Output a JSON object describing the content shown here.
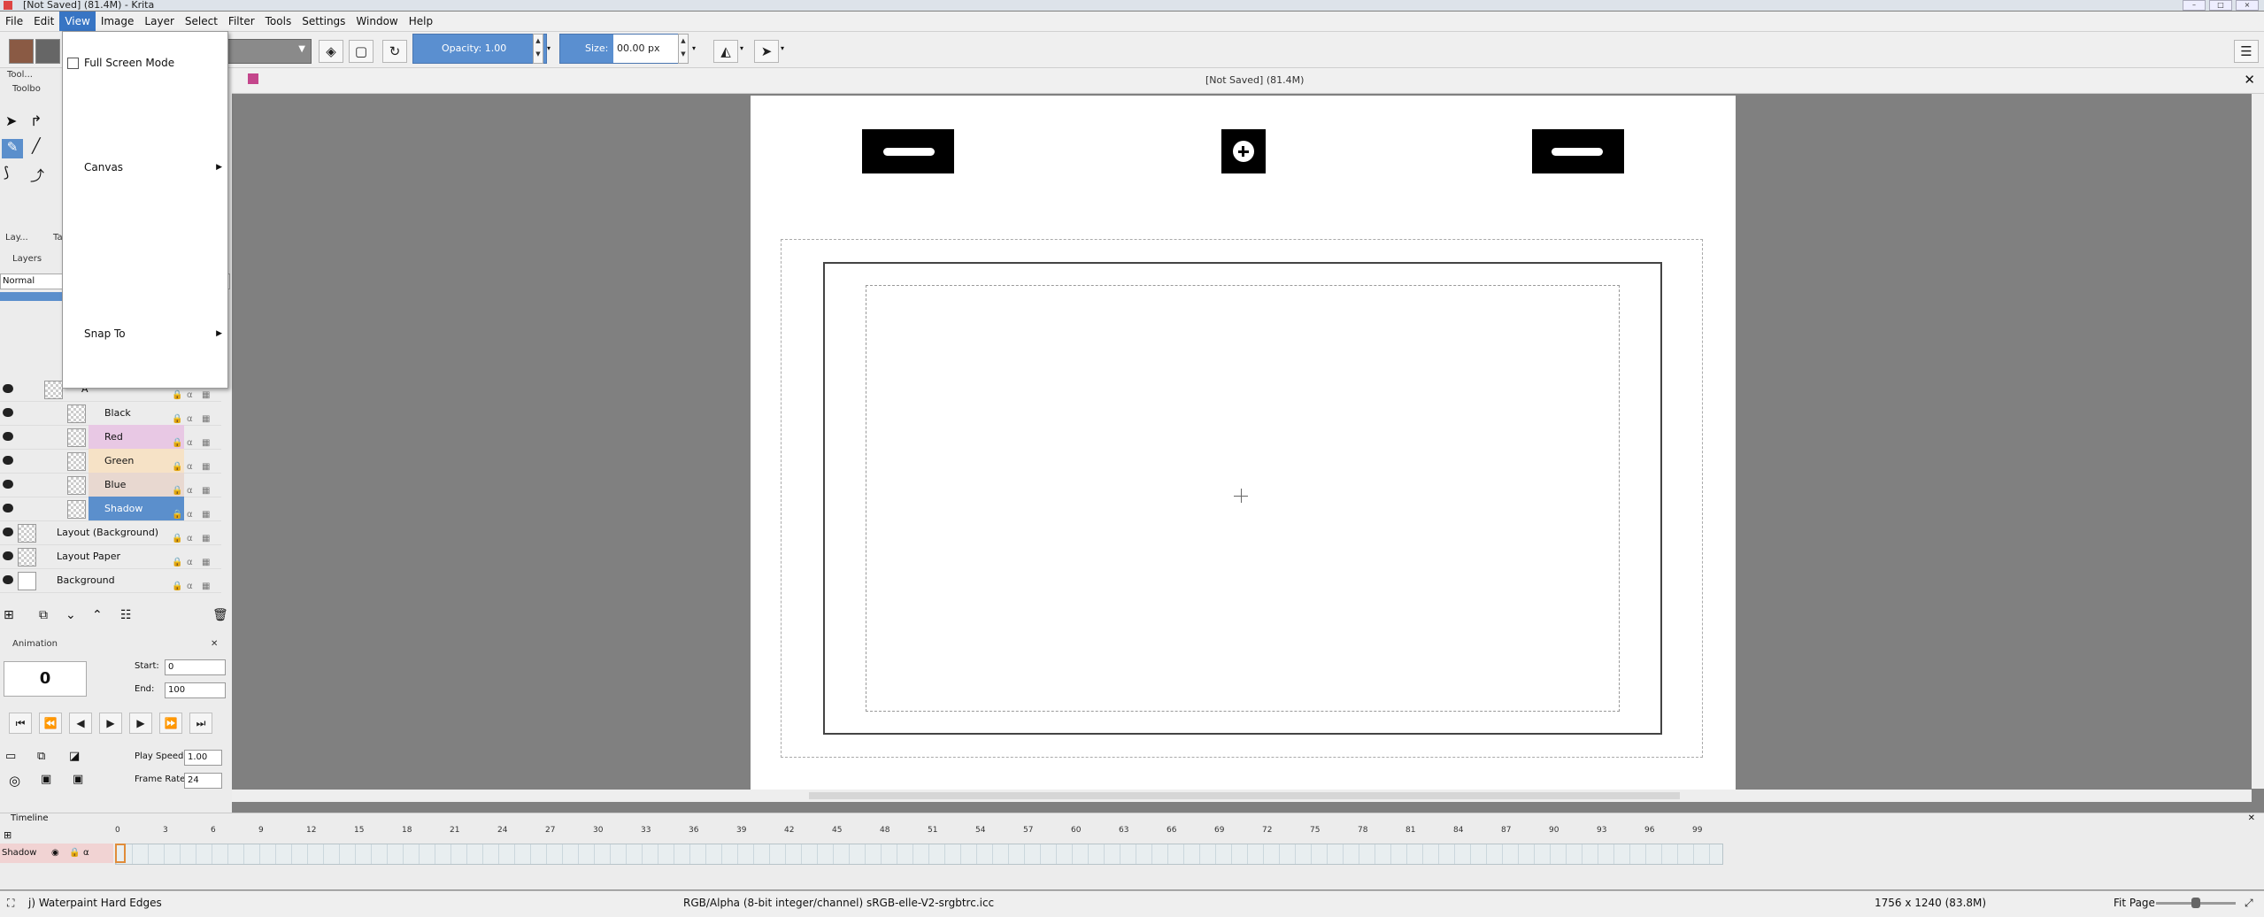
{
  "window": {
    "title": "[Not Saved]  (81.4M)  - Krita"
  },
  "menubar": {
    "items": [
      "File",
      "Edit",
      "View",
      "Image",
      "Layer",
      "Select",
      "Filter",
      "Tools",
      "Settings",
      "Window",
      "Help"
    ],
    "active": "View"
  },
  "view_menu": {
    "fullscreen_label": "Full Screen Mode",
    "canvas_label": "Canvas",
    "snap_label": "Snap To"
  },
  "toolbar": {
    "opacity_label": "Opacity:  1.00",
    "size_label": "Size:",
    "size_value": "00.00 px"
  },
  "document": {
    "title": "[Not Saved]  (81.4M)"
  },
  "dockers": {
    "tools_tab": "Tool...",
    "toolbox_label": "Toolbo",
    "layers_tab": "Lay...",
    "layers_tab2": "Ta",
    "layers_header": "Layers",
    "blend_mode": "Normal"
  },
  "layers": [
    {
      "name": "A",
      "color": "#f2f2f2"
    },
    {
      "name": "Black",
      "color": "#f2f2f2"
    },
    {
      "name": "Red",
      "color": "#e8c8e4"
    },
    {
      "name": "Green",
      "color": "#f6e2c6"
    },
    {
      "name": "Blue",
      "color": "#e8d8d0"
    },
    {
      "name": "Shadow",
      "color": "#5b8fcc",
      "selected": true
    },
    {
      "name": "Layout (Background)",
      "color": "#f2f2f2"
    },
    {
      "name": "Layout Paper",
      "color": "#f2f2f2"
    },
    {
      "name": "Background",
      "color": "#f2f2f2"
    }
  ],
  "animation": {
    "header": "Animation",
    "frame": "0",
    "start_label": "Start:",
    "start_value": "0",
    "end_label": "End:",
    "end_value": "100",
    "play_speed_label": "Play Speed:",
    "play_speed_value": "1.00",
    "frame_rate_label": "Frame Rate:",
    "frame_rate_value": "24"
  },
  "timeline": {
    "header": "Timeline",
    "layer_name": "Shadow",
    "ticks": [
      "0",
      "3",
      "6",
      "9",
      "12",
      "15",
      "18",
      "21",
      "24",
      "27",
      "30",
      "33",
      "36",
      "39",
      "42",
      "45",
      "48",
      "51",
      "54",
      "57",
      "60",
      "63",
      "66",
      "69",
      "72",
      "75",
      "78",
      "81",
      "84",
      "87",
      "90",
      "93",
      "96",
      "99"
    ]
  },
  "statusbar": {
    "brush": "j) Waterpaint Hard Edges",
    "colorspace": "RGB/Alpha (8-bit integer/channel)  sRGB-elle-V2-srgbtrc.icc",
    "dimensions": "1756 x 1240 (83.8M)",
    "zoom_mode": "Fit Page"
  },
  "colors": {
    "accent": "#3875c4",
    "selected_layer": "#5b8fcc",
    "canvas_bg": "#808080"
  }
}
